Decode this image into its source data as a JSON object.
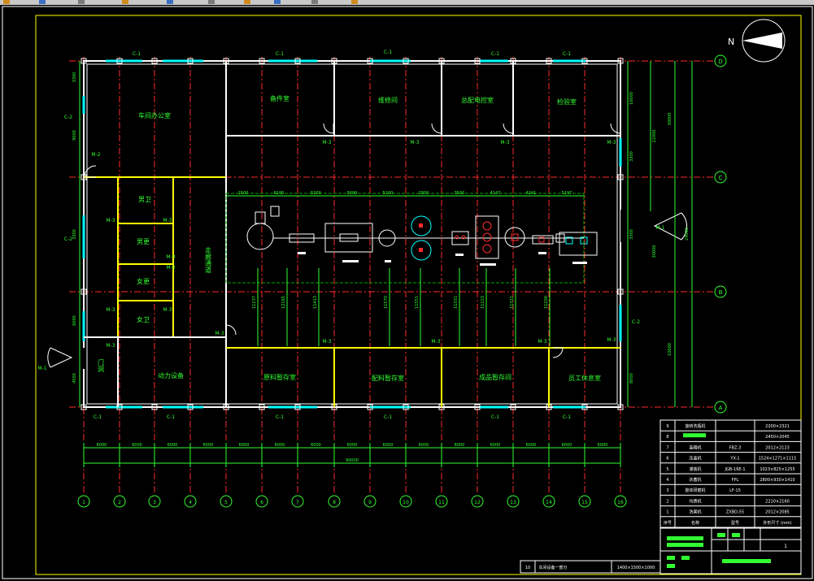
{
  "toolbar": {
    "icons": [
      "open-icon",
      "cut-icon",
      "copy-icon",
      "paste-icon",
      "undo-icon",
      "redo-icon",
      "print-icon",
      "zoom-icon",
      "pan-icon",
      "layer-icon"
    ]
  },
  "north": {
    "label": "N"
  },
  "grid": {
    "columns": [
      "1",
      "2",
      "3",
      "4",
      "5",
      "6",
      "7",
      "8",
      "9",
      "10",
      "11",
      "12",
      "13",
      "14",
      "15",
      "16"
    ],
    "rows": [
      "D",
      "C",
      "B",
      "A"
    ],
    "column_spacing_labels": [
      "6000",
      "6000",
      "6000",
      "6000",
      "6000",
      "6000",
      "6000",
      "6000",
      "6000",
      "6000",
      "6000",
      "6000",
      "6000",
      "6000",
      "6000"
    ],
    "total_length": "90000"
  },
  "rooms": [
    {
      "id": "office",
      "label": "车间办公室"
    },
    {
      "id": "spare",
      "label": "备件室"
    },
    {
      "id": "repair",
      "label": "维修间"
    },
    {
      "id": "control",
      "label": "总配电控室"
    },
    {
      "id": "lab",
      "label": "检验室"
    },
    {
      "id": "toilet_m",
      "label": "男卫"
    },
    {
      "id": "change_m",
      "label": "男更"
    },
    {
      "id": "change_f",
      "label": "女更"
    },
    {
      "id": "toilet_f",
      "label": "女卫"
    },
    {
      "id": "corridor",
      "label": "走廊通道"
    },
    {
      "id": "power",
      "label": "动力设备"
    },
    {
      "id": "door_label",
      "label": "门洞"
    },
    {
      "id": "raw",
      "label": "原料暂存室"
    },
    {
      "id": "aux",
      "label": "配料暂存室"
    },
    {
      "id": "product",
      "label": "成品暂存间"
    },
    {
      "id": "rest",
      "label": "员工休息室"
    }
  ],
  "window_tags": {
    "top": "C-1",
    "side": "C-2"
  },
  "door_tags": {
    "m1": "M-1",
    "m2": "M-2",
    "m3": "M-3"
  },
  "dims": {
    "left": [
      "3300",
      "9000",
      "3300",
      "6000",
      "4500"
    ],
    "right_inner": [
      "10000",
      "3300",
      "3300",
      "8000"
    ],
    "right_mid": [
      "22000",
      "30000"
    ],
    "right_outer": [
      "30000",
      "24000",
      "10000"
    ],
    "equipment_spacing": [
      "1500",
      "6100",
      "5200",
      "5000",
      "5100",
      "3300",
      "3500",
      "4147",
      "4241",
      "5197"
    ],
    "equipment_vertical": [
      "11237",
      "12165",
      "11413",
      "11570",
      "11551",
      "11331",
      "11223",
      "11312",
      "11200"
    ],
    "top_room_markers": [
      "C-1",
      "C-1",
      "C-1",
      "C-1"
    ]
  },
  "equipment_table": {
    "rows": [
      {
        "no": "9",
        "name": "旋转洗瓶机",
        "model": "",
        "size": "2200×2321"
      },
      {
        "no": "8",
        "name": "",
        "model": "",
        "size": "2450×2045"
      },
      {
        "no": "7",
        "name": "装箱机",
        "model": "FBZ-3",
        "size": "2012×2123"
      },
      {
        "no": "6",
        "name": "压盖机",
        "model": "YX-1",
        "size": "1524×1271×1115"
      },
      {
        "no": "5",
        "name": "灌装机",
        "model": "JGB-16E-1",
        "size": "1023×825×1255"
      },
      {
        "no": "4",
        "name": "杀菌机",
        "model": "FPL",
        "size": "2800×930×1410"
      },
      {
        "no": "3",
        "name": "胶体研磨机",
        "model": "LF-15",
        "size": ""
      },
      {
        "no": "2",
        "name": "均质机",
        "model": "",
        "size": "2210×2160"
      },
      {
        "no": "1",
        "name": "洗果机",
        "model": "ZXBD-55",
        "size": "2012×2085"
      }
    ],
    "header": {
      "no": "序号",
      "name": "名称",
      "model": "型号",
      "size": "外形尺寸 (mm)"
    },
    "sheet_no": "1",
    "bottom_title": "车间设备一部分",
    "bottom_no": "10",
    "scale_text": "1400×1500×1000"
  },
  "colors": {
    "bg": "#000000",
    "axis": "#ff2a2a",
    "wall": "#ffffff",
    "text": "#31ff31",
    "yellow": "#ffff00",
    "cyan": "#00ffff",
    "frame": "#ffff00",
    "green": "#31ff31"
  }
}
